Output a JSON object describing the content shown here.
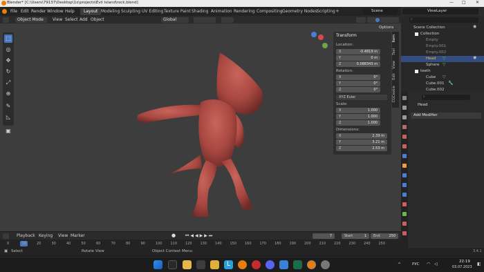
{
  "window": {
    "title": "Blender* [C:\\Users\\79137\\Desktop\\1x\\projects\\Evil Island\\rock.blend]"
  },
  "menubar": {
    "items": [
      "File",
      "Edit",
      "Render",
      "Window",
      "Help"
    ],
    "workspaces": [
      "Layout",
      "Modeling",
      "Sculpting",
      "UV Editing",
      "Texture Paint",
      "Shading",
      "Animation",
      "Rendering",
      "Compositing",
      "Geometry Nodes",
      "Scripting"
    ],
    "active_workspace": "Layout",
    "scene": "Scene",
    "view_layer": "ViewLayer"
  },
  "viewport_header": {
    "mode": "Object Mode",
    "menus": [
      "View",
      "Select",
      "Add",
      "Object"
    ],
    "orientation": "Global",
    "options": "Options"
  },
  "npanel": {
    "section": "Transform",
    "location_label": "Location:",
    "location": [
      {
        "axis": "X",
        "value": "-0.4819 m"
      },
      {
        "axis": "Y",
        "value": "0 m"
      },
      {
        "axis": "Z",
        "value": "0.088343 m"
      }
    ],
    "rotation_label": "Rotation:",
    "rotation": [
      {
        "axis": "X",
        "value": "0°"
      },
      {
        "axis": "Y",
        "value": "0°"
      },
      {
        "axis": "Z",
        "value": "0°"
      }
    ],
    "rotation_mode": "XYZ Euler",
    "scale_label": "Scale:",
    "scale": [
      {
        "axis": "X",
        "value": "1.000"
      },
      {
        "axis": "Y",
        "value": "1.000"
      },
      {
        "axis": "Z",
        "value": "1.000"
      }
    ],
    "dimensions_label": "Dimensions:",
    "dimensions": [
      {
        "axis": "X",
        "value": "2.39 m"
      },
      {
        "axis": "Y",
        "value": "3.21 m"
      },
      {
        "axis": "Z",
        "value": "2.53 m"
      }
    ],
    "tabs": [
      "Item",
      "Tool",
      "View",
      "Edit",
      "CGCookie"
    ]
  },
  "outliner": {
    "root": "Scene Collection",
    "rows": [
      "Collection",
      "Empty",
      "Empty.001",
      "Empty.002",
      "Head",
      "Sphere",
      "teeth",
      "Cube",
      "Cube.001",
      "Cube.002"
    ]
  },
  "properties": {
    "object_name": "Head",
    "add_modifier": "Add Modifier"
  },
  "timeline": {
    "menus": [
      "Playback",
      "Keying",
      "View",
      "Marker"
    ],
    "current_frame": "7",
    "start_label": "Start",
    "start": "1",
    "end_label": "End",
    "end": "250",
    "ticks": [
      "0",
      "10",
      "20",
      "30",
      "40",
      "50",
      "60",
      "70",
      "80",
      "90",
      "100",
      "110",
      "120",
      "130",
      "140",
      "150",
      "160",
      "170",
      "180",
      "190",
      "200",
      "210",
      "220",
      "230",
      "240",
      "250"
    ]
  },
  "statusbar": {
    "select": "Select",
    "rotate": "Rotate View",
    "context": "Object Context Menu",
    "version": "3.4.1"
  },
  "taskbar": {
    "lang": "РУС",
    "time": "22:19",
    "date": "03.07.2023"
  },
  "colors": {
    "accent": "#4b77be",
    "model": "#b5524a",
    "viewport": "#3d3d3d"
  }
}
